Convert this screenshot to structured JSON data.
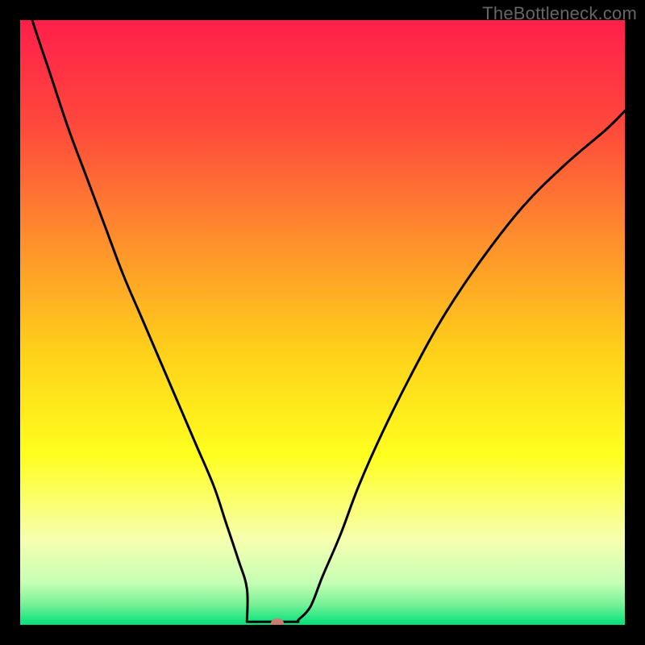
{
  "watermark": "TheBottleneck.com",
  "chart_data": {
    "type": "line",
    "title": "",
    "xlabel": "",
    "ylabel": "",
    "xlim": [
      0,
      100
    ],
    "ylim": [
      0,
      100
    ],
    "grid": false,
    "legend": false,
    "background_gradient": {
      "stops": [
        {
          "pos": 0.0,
          "color": "#ff1f4b"
        },
        {
          "pos": 0.18,
          "color": "#ff4a3b"
        },
        {
          "pos": 0.35,
          "color": "#ff8a2e"
        },
        {
          "pos": 0.55,
          "color": "#ffd11a"
        },
        {
          "pos": 0.72,
          "color": "#ffff1e"
        },
        {
          "pos": 0.86,
          "color": "#f6ffb0"
        },
        {
          "pos": 0.93,
          "color": "#c6ffb5"
        },
        {
          "pos": 0.965,
          "color": "#7bf298"
        },
        {
          "pos": 1.0,
          "color": "#00e17a"
        }
      ]
    },
    "series": [
      {
        "name": "bottleneck-curve",
        "color": "#000000",
        "x": [
          0,
          2,
          5,
          8,
          11,
          14,
          17,
          20,
          23,
          26,
          29,
          32,
          34,
          36,
          37.5,
          39,
          40.5,
          41.5,
          46,
          48,
          50,
          53,
          56,
          60,
          65,
          70,
          76,
          83,
          90,
          97,
          100
        ],
        "y": [
          107,
          100,
          91,
          82,
          74,
          66,
          58,
          51,
          44,
          37,
          30,
          23,
          17,
          11,
          6,
          2.5,
          0.8,
          0.5,
          0.8,
          3,
          8,
          15,
          23,
          32,
          42,
          51,
          60,
          69,
          76,
          82,
          85
        ]
      }
    ],
    "marker": {
      "x": 42.5,
      "y": 0.3,
      "color": "#cb7a72"
    },
    "flat_bottom": {
      "x_start": 37.5,
      "x_end": 46,
      "y": 0.5
    }
  }
}
